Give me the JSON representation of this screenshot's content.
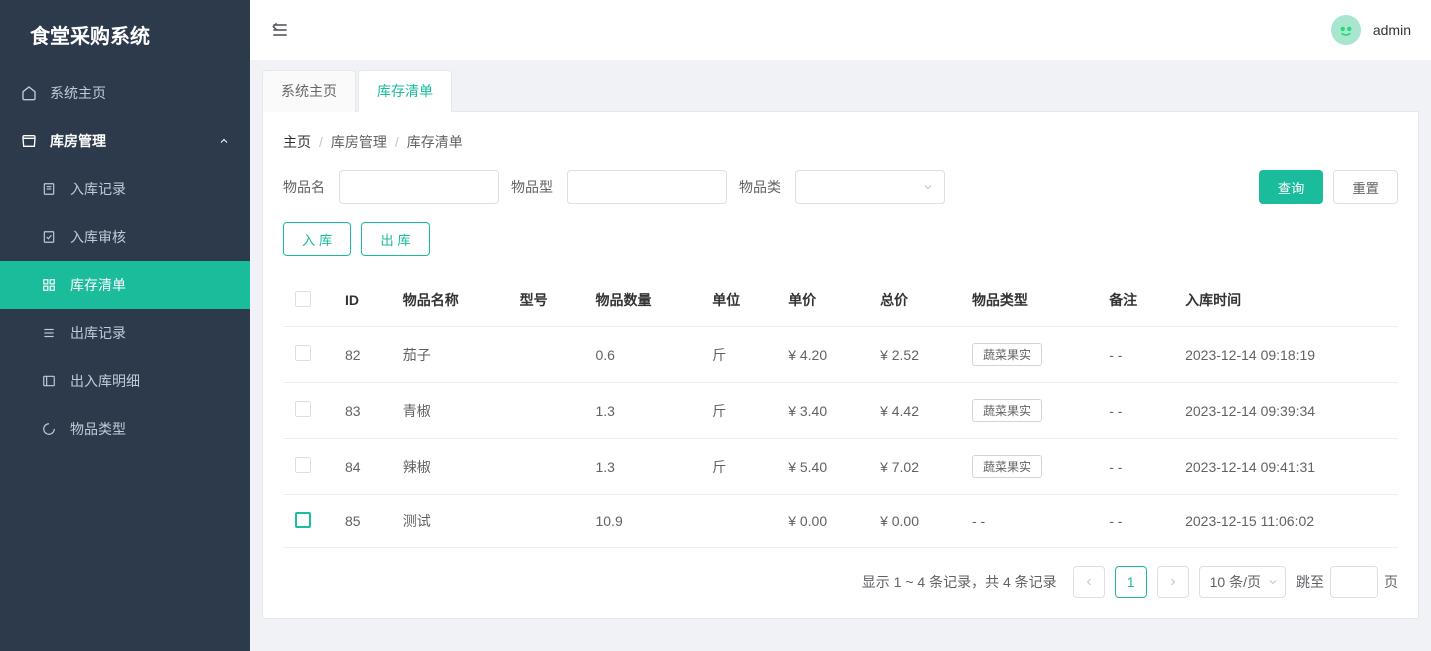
{
  "app_title": "食堂采购系统",
  "user_name": "admin",
  "sidebar": {
    "home_label": "系统主页",
    "group_label": "库房管理",
    "items": [
      {
        "label": "入库记录"
      },
      {
        "label": "入库审核"
      },
      {
        "label": "库存清单"
      },
      {
        "label": "出库记录"
      },
      {
        "label": "出入库明细"
      },
      {
        "label": "物品类型"
      }
    ]
  },
  "tabs": [
    {
      "label": "系统主页"
    },
    {
      "label": "库存清单"
    }
  ],
  "breadcrumb": [
    "主页",
    "库房管理",
    "库存清单"
  ],
  "filters": {
    "name_label": "物品名",
    "model_label": "物品型",
    "type_label": "物品类",
    "query_btn": "查询",
    "reset_btn": "重置"
  },
  "action_btns": {
    "in": "入 库",
    "out": "出 库"
  },
  "table": {
    "headers": [
      "ID",
      "物品名称",
      "型号",
      "物品数量",
      "单位",
      "单价",
      "总价",
      "物品类型",
      "备注",
      "入库时间"
    ],
    "rows": [
      {
        "id": "82",
        "name": "茄子",
        "model": "",
        "qty": "0.6",
        "unit": "斤",
        "price": "¥ 4.20",
        "total": "¥ 2.52",
        "type": "蔬菜果实",
        "remark": "- -",
        "time": "2023-12-14 09:18:19",
        "selected": false
      },
      {
        "id": "83",
        "name": "青椒",
        "model": "",
        "qty": "1.3",
        "unit": "斤",
        "price": "¥ 3.40",
        "total": "¥ 4.42",
        "type": "蔬菜果实",
        "remark": "- -",
        "time": "2023-12-14 09:39:34",
        "selected": false
      },
      {
        "id": "84",
        "name": "辣椒",
        "model": "",
        "qty": "1.3",
        "unit": "斤",
        "price": "¥ 5.40",
        "total": "¥ 7.02",
        "type": "蔬菜果实",
        "remark": "- -",
        "time": "2023-12-14 09:41:31",
        "selected": false
      },
      {
        "id": "85",
        "name": "测试",
        "model": "",
        "qty": "10.9",
        "unit": "",
        "price": "¥ 0.00",
        "total": "¥ 0.00",
        "type": "- -",
        "remark": "- -",
        "time": "2023-12-15 11:06:02",
        "selected": true
      }
    ]
  },
  "pager": {
    "info": "显示 1 ~ 4 条记录，共 4 条记录",
    "current": "1",
    "size": "10 条/页",
    "jump_label": "跳至",
    "page_suffix": "页"
  }
}
